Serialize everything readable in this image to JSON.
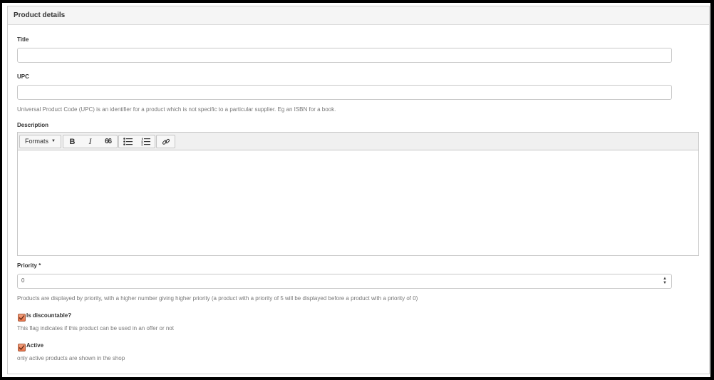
{
  "panel": {
    "title": "Product details"
  },
  "fields": {
    "title": {
      "label": "Title",
      "value": ""
    },
    "upc": {
      "label": "UPC",
      "value": "",
      "help": "Universal Product Code (UPC) is an identifier for a product which is not specific to a particular supplier. Eg an ISBN for a book."
    },
    "description": {
      "label": "Description",
      "toolbar": {
        "formats_label": "Formats",
        "bold_label": "B",
        "italic_label": "I",
        "quote_label": "66"
      },
      "value": ""
    },
    "priority": {
      "label": "Priority *",
      "value": "0",
      "help": "Products are displayed by priority, with a higher number giving higher priority (a product with a priority of 5 will be displayed before a product with a priority of 0)"
    },
    "is_discountable": {
      "label": "Is discountable?",
      "checked": true,
      "help": "This flag indicates if this product can be used in an offer or not"
    },
    "active": {
      "label": "Active",
      "checked": true,
      "help": "only active products are shown in the shop"
    }
  },
  "colors": {
    "checkbox_fill": "#e8744b",
    "panel_heading_bg": "#f5f5f5"
  }
}
